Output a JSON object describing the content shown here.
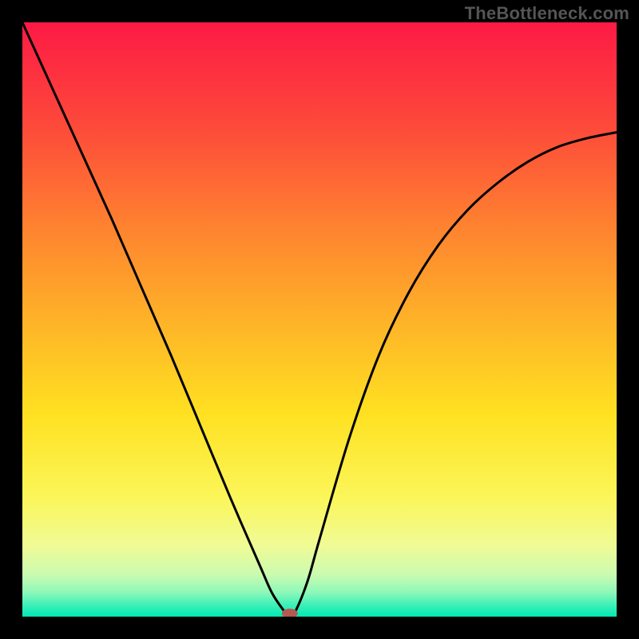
{
  "watermark": "TheBottleneck.com",
  "chart_data": {
    "type": "line",
    "title": "",
    "xlabel": "",
    "ylabel": "",
    "xlim": [
      0,
      1
    ],
    "ylim": [
      0,
      1
    ],
    "legend": false,
    "grid": false,
    "background_gradient": {
      "top": "#fd1a45",
      "mid": "#ffe121",
      "bottom": "#00e8b4"
    },
    "series": [
      {
        "name": "bottleneck-curve",
        "x": [
          0.0,
          0.05,
          0.1,
          0.15,
          0.2,
          0.25,
          0.3,
          0.35,
          0.4,
          0.42,
          0.44,
          0.45,
          0.46,
          0.48,
          0.5,
          0.55,
          0.6,
          0.65,
          0.7,
          0.75,
          0.8,
          0.85,
          0.9,
          0.95,
          1.0
        ],
        "values": [
          1.0,
          0.89,
          0.78,
          0.67,
          0.555,
          0.44,
          0.32,
          0.2,
          0.085,
          0.04,
          0.01,
          0.0,
          0.01,
          0.06,
          0.13,
          0.3,
          0.44,
          0.545,
          0.625,
          0.685,
          0.73,
          0.765,
          0.79,
          0.805,
          0.815
        ]
      }
    ],
    "annotations": [
      {
        "name": "minimum-marker",
        "x": 0.45,
        "y": 0.0,
        "shape": "ellipse",
        "color": "#b45a52"
      }
    ]
  }
}
